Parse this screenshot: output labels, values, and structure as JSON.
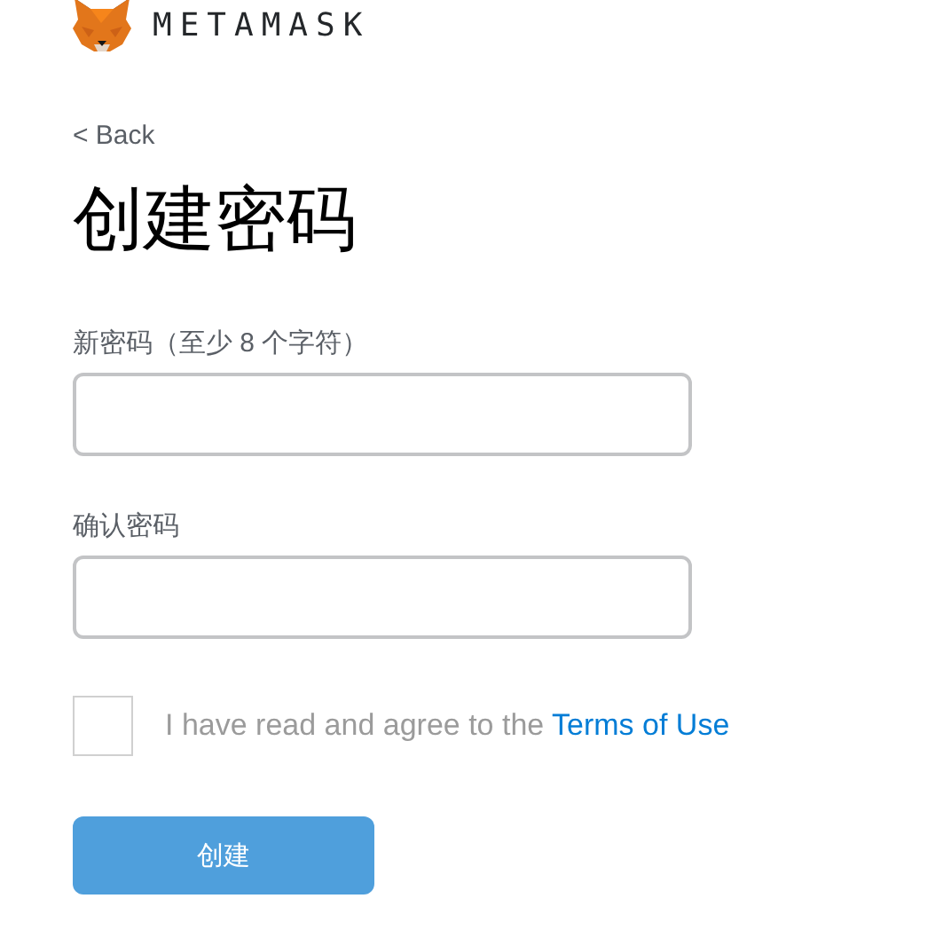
{
  "header": {
    "brand": "METAMASK"
  },
  "back_link": "< Back",
  "title": "创建密码",
  "fields": [
    {
      "label": "新密码（至少 8 个字符）"
    },
    {
      "label": "确认密码"
    }
  ],
  "terms": {
    "checked": false,
    "text": "I have read and agree to the ",
    "link": "Terms of Use"
  },
  "create_button": {
    "label": "创建",
    "disabled": true
  }
}
